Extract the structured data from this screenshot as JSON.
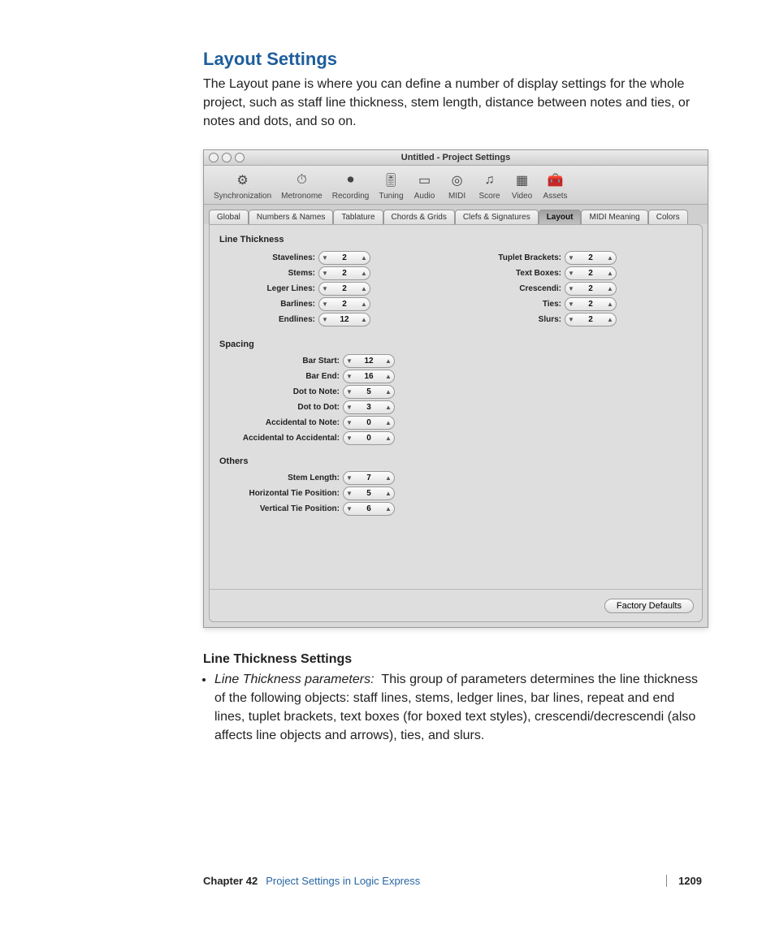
{
  "heading": "Layout Settings",
  "intro": "The Layout pane is where you can define a number of display settings for the whole project, such as staff line thickness, stem length, distance between notes and ties, or notes and dots, and so on.",
  "window_title": "Untitled - Project Settings",
  "toolbar": [
    {
      "name": "synchronization",
      "label": "Synchronization",
      "glyph": "⚙"
    },
    {
      "name": "metronome",
      "label": "Metronome",
      "glyph": "⏱"
    },
    {
      "name": "recording",
      "label": "Recording",
      "glyph": "⏺"
    },
    {
      "name": "tuning",
      "label": "Tuning",
      "glyph": "🎚"
    },
    {
      "name": "audio",
      "label": "Audio",
      "glyph": "▭"
    },
    {
      "name": "midi",
      "label": "MIDI",
      "glyph": "◎"
    },
    {
      "name": "score",
      "label": "Score",
      "glyph": "♫"
    },
    {
      "name": "video",
      "label": "Video",
      "glyph": "▦"
    },
    {
      "name": "assets",
      "label": "Assets",
      "glyph": "🧰"
    }
  ],
  "tabs": [
    "Global",
    "Numbers & Names",
    "Tablature",
    "Chords & Grids",
    "Clefs & Signatures",
    "Layout",
    "MIDI Meaning",
    "Colors"
  ],
  "active_tab": "Layout",
  "sections": {
    "line_thickness": {
      "title": "Line Thickness",
      "left": [
        {
          "label": "Stavelines:",
          "value": "2"
        },
        {
          "label": "Stems:",
          "value": "2"
        },
        {
          "label": "Leger Lines:",
          "value": "2"
        },
        {
          "label": "Barlines:",
          "value": "2"
        },
        {
          "label": "Endlines:",
          "value": "12"
        }
      ],
      "right": [
        {
          "label": "Tuplet Brackets:",
          "value": "2"
        },
        {
          "label": "Text Boxes:",
          "value": "2"
        },
        {
          "label": "Crescendi:",
          "value": "2"
        },
        {
          "label": "Ties:",
          "value": "2"
        },
        {
          "label": "Slurs:",
          "value": "2"
        }
      ]
    },
    "spacing": {
      "title": "Spacing",
      "rows": [
        {
          "label": "Bar Start:",
          "value": "12"
        },
        {
          "label": "Bar End:",
          "value": "16"
        },
        {
          "label": "Dot to Note:",
          "value": "5"
        },
        {
          "label": "Dot to Dot:",
          "value": "3"
        },
        {
          "label": "Accidental to Note:",
          "value": "0"
        },
        {
          "label": "Accidental to Accidental:",
          "value": "0"
        }
      ]
    },
    "others": {
      "title": "Others",
      "rows": [
        {
          "label": "Stem Length:",
          "value": "7"
        },
        {
          "label": "Horizontal Tie Position:",
          "value": "5"
        },
        {
          "label": "Vertical Tie Position:",
          "value": "6"
        }
      ]
    }
  },
  "factory_defaults": "Factory Defaults",
  "sub_heading": "Line Thickness Settings",
  "bullet_lead": "Line Thickness parameters:",
  "bullet_body": "This group of parameters determines the line thickness of the following objects:  staff lines, stems, ledger lines, bar lines, repeat and end lines, tuplet brackets, text boxes (for boxed text styles), crescendi/decrescendi (also affects line objects and arrows), ties, and slurs.",
  "footer": {
    "chapter": "Chapter 42",
    "title": "Project Settings in Logic Express",
    "page": "1209"
  }
}
